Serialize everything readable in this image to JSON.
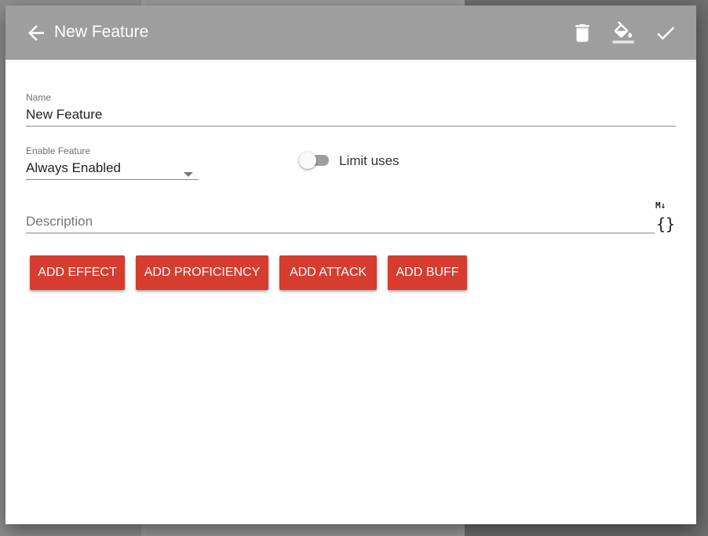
{
  "dialog": {
    "title": "New Feature",
    "toolbar": {
      "back_icon": "arrow-back-icon",
      "delete_icon": "trash-icon",
      "color_icon": "paint-bucket-icon",
      "confirm_icon": "check-icon"
    }
  },
  "form": {
    "name": {
      "label": "Name",
      "value": "New Feature"
    },
    "enable": {
      "label": "Enable Feature",
      "value": "Always Enabled"
    },
    "limit_uses": {
      "label": "Limit uses",
      "on": false
    },
    "description": {
      "placeholder": "Description",
      "markdown_icon": "M↓",
      "code_icon": "{}"
    }
  },
  "buttons": {
    "add_effect": "ADD EFFECT",
    "add_proficiency": "ADD PROFICIENCY",
    "add_attack": "ADD ATTACK",
    "add_buff": "ADD BUFF"
  },
  "colors": {
    "toolbar": "#9e9e9e",
    "accent": "#d63c2f"
  }
}
